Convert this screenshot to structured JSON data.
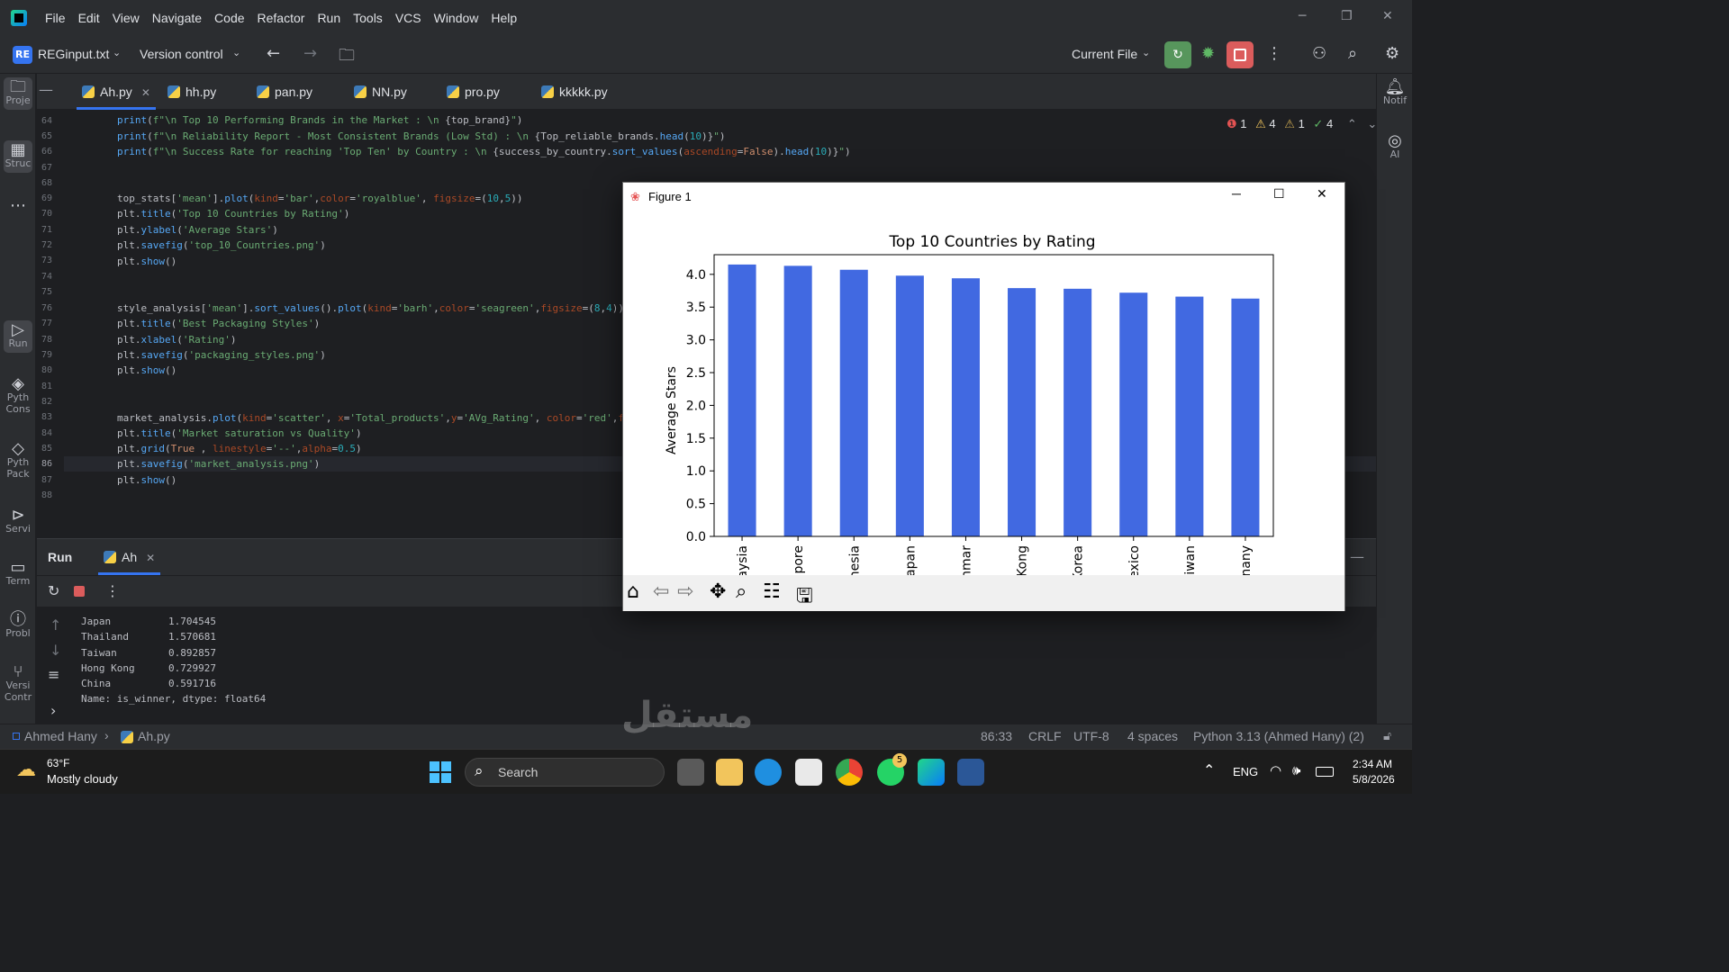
{
  "menu": {
    "items": [
      "File",
      "Edit",
      "View",
      "Navigate",
      "Code",
      "Refactor",
      "Run",
      "Tools",
      "VCS",
      "Window",
      "Help"
    ]
  },
  "toolbar": {
    "project_badge": "RE",
    "project_name": "REGinput.txt",
    "version_control": "Version control",
    "run_config": "Current File"
  },
  "left_strip": {
    "project": "Proje",
    "structure": "Struc",
    "run": "Run",
    "python_console": "Pyth Cons",
    "python_packages": "Pyth Pack",
    "services": "Servi",
    "terminal": "Term",
    "problems": "Probl",
    "version_control": "Versi Contr"
  },
  "right_strip": {
    "notifications": "Notif",
    "ai": "AI"
  },
  "tabs": [
    "Ah.py",
    "hh.py",
    "pan.py",
    "NN.py",
    "pro.py",
    "kkkkk.py"
  ],
  "inspections": {
    "errors": "1",
    "warnings": "4",
    "weak_warnings": "1",
    "ok": "4"
  },
  "editor": {
    "line_numbers": [
      "64",
      "65",
      "66",
      "67",
      "68",
      "69",
      "70",
      "71",
      "72",
      "73",
      "74",
      "75",
      "76",
      "77",
      "78",
      "79",
      "80",
      "81",
      "82",
      "83",
      "84",
      "85",
      "86",
      "87",
      "88"
    ]
  },
  "run_panel": {
    "title": "Run",
    "tab": "Ah",
    "output": [
      {
        "name": "Japan",
        "value": "1.704545"
      },
      {
        "name": "Thailand",
        "value": "1.570681"
      },
      {
        "name": "Taiwan",
        "value": "0.892857"
      },
      {
        "name": "Hong Kong",
        "value": "0.729927"
      },
      {
        "name": "China",
        "value": "0.591716"
      }
    ],
    "footer": "Name: is_winner, dtype: float64"
  },
  "statusbar": {
    "project": "Ahmed Hany",
    "file": "Ah.py",
    "position": "86:33",
    "line_sep": "CRLF",
    "encoding": "UTF-8",
    "indent": "4 spaces",
    "interpreter": "Python 3.13 (Ahmed Hany) (2)"
  },
  "taskbar": {
    "temperature": "63°F",
    "weather": "Mostly cloudy",
    "search_placeholder": "Search",
    "language": "ENG",
    "time": "2:34 AM",
    "date": "5/8/2026",
    "whatsapp_badge": "5"
  },
  "figure": {
    "window_title": "Figure 1"
  },
  "watermark": "مستقل",
  "chart_data": {
    "type": "bar",
    "title": "Top 10 Countries by Rating",
    "ylabel": "Average Stars",
    "xlabel": "",
    "ylim": [
      0,
      4.3
    ],
    "yticks": [
      "0.0",
      "0.5",
      "1.0",
      "1.5",
      "2.0",
      "2.5",
      "3.0",
      "3.5",
      "4.0"
    ],
    "categories": [
      "aysia",
      "pore",
      "nesia",
      "apan",
      "nmar",
      "Kong",
      "Korea",
      "exico",
      "iwan",
      "nany"
    ],
    "values": [
      4.15,
      4.13,
      4.07,
      3.98,
      3.94,
      3.79,
      3.78,
      3.72,
      3.66,
      3.63
    ],
    "color": "#4169e1",
    "grid": false,
    "legend": "none"
  }
}
